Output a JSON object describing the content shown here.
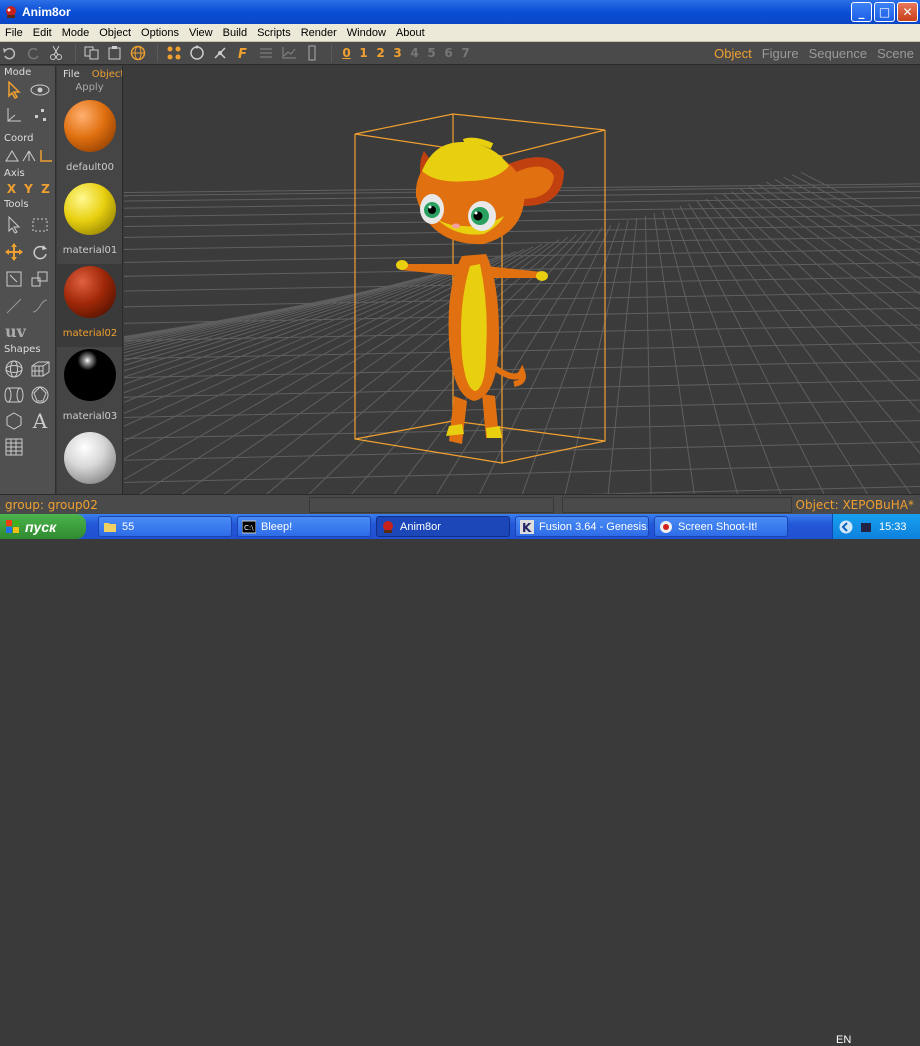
{
  "window": {
    "title": "Anim8or",
    "min": "_",
    "max": "□",
    "close": "✕"
  },
  "menu": [
    "File",
    "Edit",
    "Mode",
    "Object",
    "Options",
    "View",
    "Build",
    "Scripts",
    "Render",
    "Window",
    "About"
  ],
  "toolbar": {
    "frames": [
      "0",
      "1",
      "2",
      "3",
      "4",
      "5",
      "6",
      "7"
    ]
  },
  "viewtabs": [
    "Object",
    "Figure",
    "Sequence",
    "Scene"
  ],
  "leftpanel": {
    "mode": "Mode",
    "coord": "Coord",
    "axis": "Axis",
    "axes": [
      "X",
      "Y",
      "Z"
    ],
    "tools": "Tools",
    "uv": "uv",
    "shapes": "Shapes",
    "text_tool": "A"
  },
  "materials": {
    "tab_file": "File",
    "tab_object": "Object",
    "apply": "Apply",
    "items": [
      {
        "name": "default00",
        "color": "#e07010"
      },
      {
        "name": "material01",
        "color": "#e8d010"
      },
      {
        "name": "material02",
        "color": "#a02808"
      },
      {
        "name": "material03",
        "color": "#000000"
      },
      {
        "name": "",
        "color": "#d8d8d8"
      }
    ]
  },
  "status": {
    "left": "group: group02",
    "right": "Object: XEPOBuHA*"
  },
  "taskbar": {
    "start": "пуск",
    "tasks": [
      "55",
      "Bleep!",
      "Anim8or",
      "Fusion 3.64 - Genesis...",
      "Screen Shoot-It!"
    ],
    "lang": "EN",
    "clock": "15:33"
  }
}
